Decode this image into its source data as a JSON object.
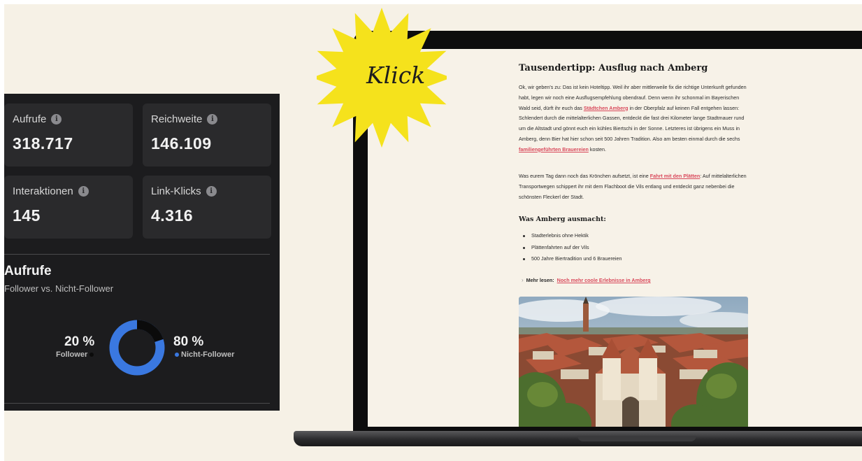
{
  "stats": {
    "cards": [
      {
        "label": "Aufrufe",
        "value": "318.717"
      },
      {
        "label": "Reichweite",
        "value": "146.109"
      },
      {
        "label": "Interaktionen",
        "value": "145"
      },
      {
        "label": "Link-Klicks",
        "value": "4.316"
      }
    ],
    "views_title": "Aufrufe",
    "views_subtitle": "Follower vs. Nicht-Follower",
    "follower_pct": "20 %",
    "follower_label": "Follower",
    "nonfollower_pct": "80 %",
    "nonfollower_label": "Nicht-Follower",
    "follower_fraction": 0.2,
    "colors": {
      "follower": "#0b0b0b",
      "nonfollower": "#3a78e0"
    }
  },
  "badge": {
    "text": "Klick",
    "color": "#f5e21c"
  },
  "article": {
    "title": "Tausendertipp: Ausflug nach Amberg",
    "p1_a": "Ok, wir geben's zu: Das ist kein Hoteltipp. Weil ihr aber mittlerweile fix die richtige Unterkunft gefunden habt, legen wir noch eine Ausflugsempfehlung obendrauf. Denn wenn ihr schonmal im Bayerischen Wald seid, dürft ihr euch das ",
    "p1_link1": "Städtchen Amberg",
    "p1_b": " in der Oberpfalz auf keinen Fall entgehen lassen: Schlendert durch die mittelalterlichen Gassen, entdeckt die fast drei Kilometer lange Stadtmauer rund um die Altstadt und gönnt euch ein kühles Biertschi in der Sonne. Letzteres ist übrigens ein Muss in Amberg, denn Bier hat hier schon seit 500 Jahren Tradition. Also am besten einmal durch die sechs ",
    "p1_link2": "familiengeführten Brauereien",
    "p1_c": " kosten.",
    "p2_a": "Was eurem Tag dann noch das Krönchen aufsetzt, ist eine ",
    "p2_link": "Fahrt mit den Plätten",
    "p2_b": ": Auf mittelalterlichen Transportwegen schippert ihr mit dem Flachboot die Vils entlang und entdeckt ganz nebenbei die schönsten Fleckerl der Stadt.",
    "subhead": "Was Amberg ausmacht:",
    "bullets": [
      "Stadterlebnis ohne Hektik",
      "Plättenfahrten auf der Vils",
      "500 Jahre Biertradition und 6 Brauereien"
    ],
    "read_more_arrow": "›",
    "read_more_label": "Mehr lesen:",
    "read_more_link": "Noch mehr coole Erlebnisse in Amberg"
  }
}
